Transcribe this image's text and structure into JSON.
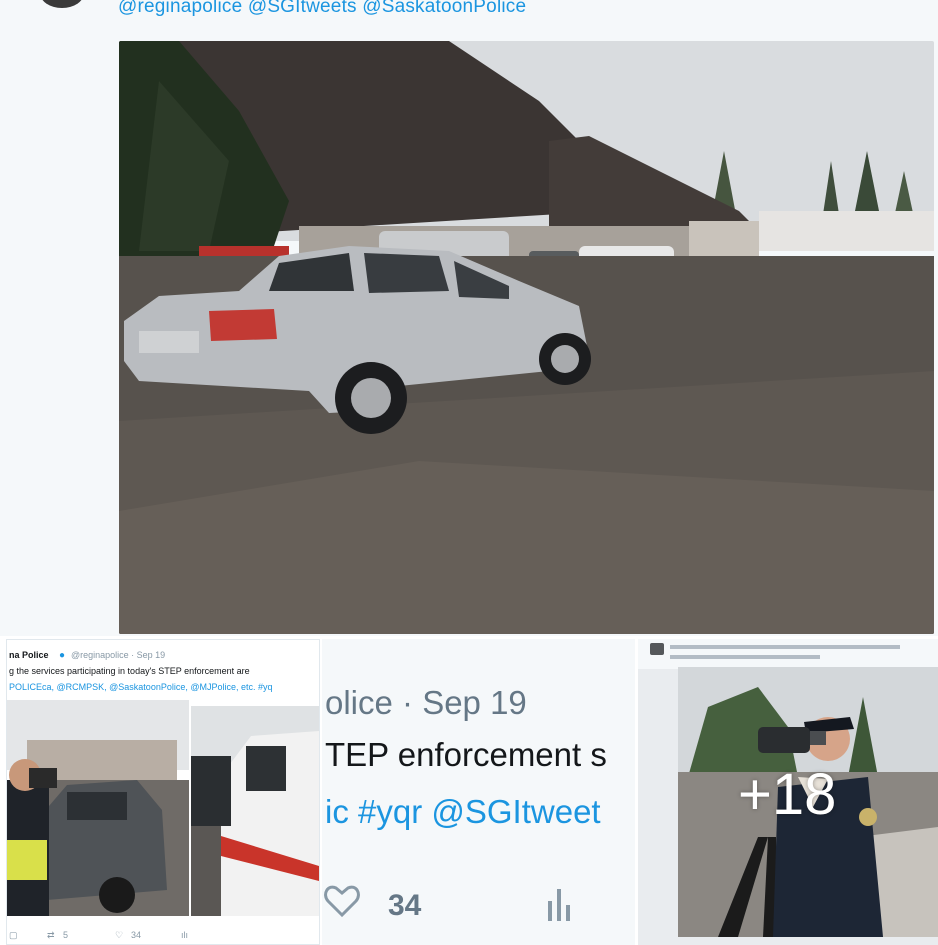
{
  "top_tweet": {
    "mentions": "@reginapolice @SGItweets @SaskatoonPolice"
  },
  "left_tile": {
    "display_name": "na Police",
    "handle_date": "@reginapolice · Sep 19",
    "text_line1": "g the services participating in today's STEP enforcement are",
    "text_line2": "POLICEca, @RCMPSK, @SaskatoonPolice, @MJPolice, etc. #yq",
    "retweet_count": "5",
    "like_count": "34"
  },
  "mid_tile": {
    "handle_date": "olice · Sep 19",
    "body": "TEP enforcement s",
    "tags": "ic #yqr @SGItweet",
    "like_count": "34"
  },
  "right_tile": {
    "more_count": "+18"
  },
  "colors": {
    "link_blue": "#1b95e0",
    "secondary_gray": "#657786",
    "background": "#f5f8fa"
  }
}
